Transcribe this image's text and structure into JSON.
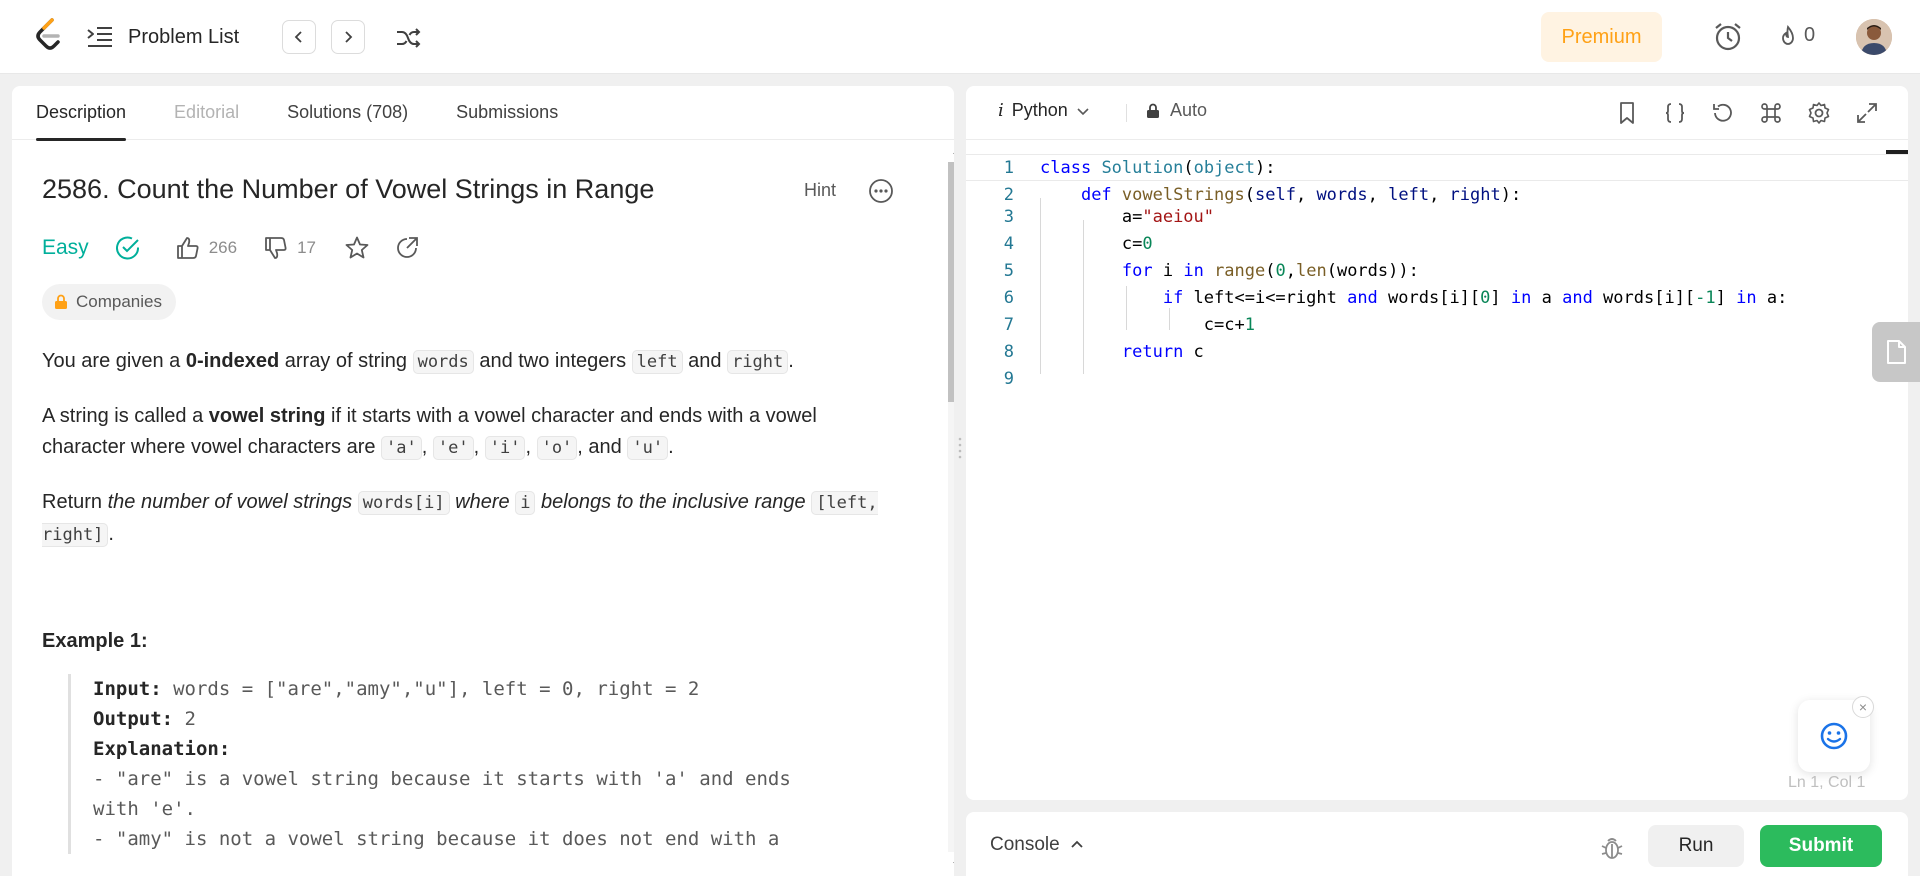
{
  "header": {
    "problem_list_label": "Problem List",
    "premium_label": "Premium",
    "streak_count": "0"
  },
  "tabs": [
    {
      "label": "Description"
    },
    {
      "label": "Editorial"
    },
    {
      "label": "Solutions (708)"
    },
    {
      "label": "Submissions"
    }
  ],
  "problem": {
    "title": "2586. Count the Number of Vowel Strings in Range",
    "hint_label": "Hint",
    "difficulty": "Easy",
    "likes": "266",
    "dislikes": "17",
    "companies_label": "Companies",
    "p1": {
      "a": "You are given a ",
      "b": "0-indexed",
      "c": " array of string ",
      "code1": "words",
      "d": " and two integers ",
      "code2": "left",
      "e": " and ",
      "code3": "right",
      "f": "."
    },
    "p2": {
      "a": "A string is called a ",
      "b": "vowel string",
      "c": " if it starts with a vowel character and ends with a vowel character where vowel characters are ",
      "v1": "'a'",
      "v2": "'e'",
      "v3": "'i'",
      "v4": "'o'",
      "v5": "'u'",
      "sep": ", ",
      "and": ", and ",
      "end": "."
    },
    "p3": {
      "a": "Return ",
      "b": "the number of vowel strings ",
      "code1": "words[i]",
      "c": " where ",
      "code2": "i",
      "d": " belongs to the inclusive range ",
      "code3": "[left, right]",
      "end": "."
    },
    "example1": {
      "title": "Example 1:",
      "input_label": "Input:",
      "input_value": " words = [\"are\",\"amy\",\"u\"], left = 0, right = 2",
      "output_label": "Output:",
      "output_value": " 2",
      "explanation_label": "Explanation:",
      "line1": "- \"are\" is a vowel string because it starts with 'a' and ends",
      "line1b": "with 'e'.",
      "line2": "- \"amy\" is not a vowel string because it does not end with a"
    }
  },
  "editor": {
    "language": "Python",
    "lang_badge": "i",
    "mode": "Auto",
    "cursor_position": "Ln 1, Col 1",
    "line_numbers": [
      "1",
      "2",
      "3",
      "4",
      "5",
      "6",
      "7",
      "8",
      "9"
    ]
  },
  "console": {
    "console_label": "Console",
    "run_label": "Run",
    "submit_label": "Submit"
  },
  "colors": {
    "easy": "#00af9b",
    "premium_text": "#ffa116",
    "submit_bg": "#2cbb5d"
  }
}
